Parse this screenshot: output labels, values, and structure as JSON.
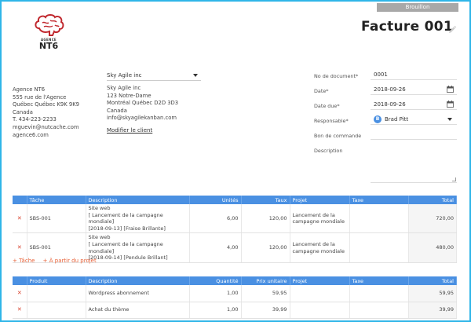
{
  "header": {
    "status": "Brouillon",
    "logo_agence": "AGENCE",
    "logo_name": "NT6",
    "title": "Facture 001"
  },
  "company": {
    "lines": [
      "Agence NT6",
      "555 rue de l'Agence",
      "Québec Québec K9K 9K9",
      "Canada",
      "T. 434-223-2233",
      "mguevin@nutcache.com",
      "agence6.com"
    ]
  },
  "client": {
    "selected": "Sky Agile inc",
    "lines": [
      "Sky Agile inc",
      "123 Notre-Dame",
      "Montréal Québec D2D 3D3",
      "Canada",
      "info@skyagilekanban.com"
    ],
    "modify_label": "Modifier le client"
  },
  "form": {
    "doc_no_label": "No de document*",
    "doc_no_value": "0001",
    "date_label": "Date*",
    "date_value": "2018-09-26",
    "due_label": "Date due*",
    "due_value": "2018-09-26",
    "resp_label": "Responsable*",
    "resp_initial": "B",
    "resp_value": "Brad Pitt",
    "po_label": "Bon de commande",
    "po_value": "",
    "desc_label": "Description"
  },
  "tasks": {
    "headers": [
      "Tâche",
      "Description",
      "Unités",
      "Taux",
      "Projet",
      "Taxe",
      "Total"
    ],
    "rows": [
      {
        "task": "SBS-001",
        "desc": [
          "Site web",
          "[ Lancement de la campagne mondiale]",
          "[2018-09-13] [Fraise Brillante]"
        ],
        "units": "6,00",
        "rate": "120,00",
        "project": [
          "Lancement de la",
          "campagne mondiale"
        ],
        "tax": "",
        "total": "720,00"
      },
      {
        "task": "SBS-001",
        "desc": [
          "Site web",
          "[ Lancement de la campagne mondiale]",
          "[2018-09-14] [Pendule Brillant]"
        ],
        "units": "4,00",
        "rate": "120,00",
        "project": [
          "Lancement de la",
          "campagne mondiale"
        ],
        "tax": "",
        "total": "480,00"
      }
    ],
    "add_task": "+ Tâche",
    "add_from_project": "+ À partir du projet"
  },
  "products": {
    "headers": [
      "Produit",
      "Description",
      "Quantité",
      "Prix unitaire",
      "Projet",
      "Taxe",
      "Total"
    ],
    "rows": [
      {
        "product": "",
        "desc": "Wordpress abonnement",
        "qty": "1,00",
        "price": "59,95",
        "project": "",
        "tax": "",
        "total": "59,95"
      },
      {
        "product": "",
        "desc": "Achat du thème",
        "qty": "1,00",
        "price": "39,99",
        "project": "",
        "tax": "",
        "total": "39,99"
      }
    ]
  },
  "colors": {
    "accent": "#4a90e2",
    "frame": "#2fb6e8",
    "delete": "#d9432f",
    "add_link": "#e8643b",
    "logo": "#c0272d"
  },
  "icons": [
    "brain-logo-icon",
    "pencil-icon",
    "calendar-icon",
    "delete-x-icon",
    "chevron-down-icon"
  ]
}
